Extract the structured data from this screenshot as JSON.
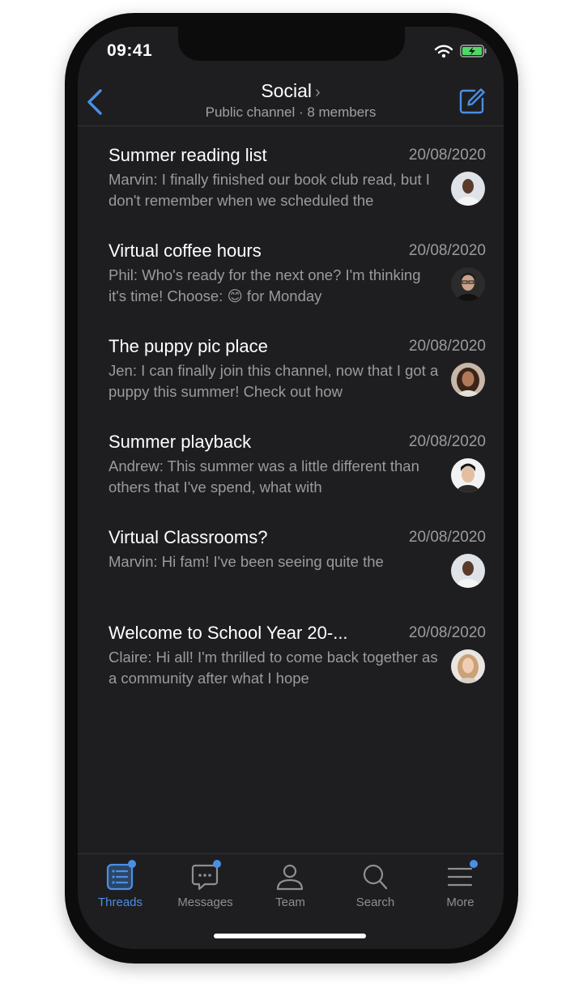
{
  "status": {
    "time": "09:41"
  },
  "header": {
    "title": "Social",
    "subtitle": "Public channel · 8 members"
  },
  "threads": [
    {
      "title": "Summer reading list",
      "date": "20/08/2020",
      "preview": "Marvin: I finally finished our book club read, but I don't remember when we scheduled the",
      "avatar": "avatar-marvin"
    },
    {
      "title": "Virtual coffee hours",
      "date": "20/08/2020",
      "preview": "Phil: Who's ready for the next one? I'm thinking it's time! Choose: 😊 for Monday",
      "avatar": "avatar-phil"
    },
    {
      "title": "The puppy pic place",
      "date": "20/08/2020",
      "preview": "Jen: I can finally join this channel, now that I got a puppy this summer! Check out how",
      "avatar": "avatar-jen"
    },
    {
      "title": "Summer playback",
      "date": "20/08/2020",
      "preview": "Andrew: This summer was a little different than others that I've spend, what with",
      "avatar": "avatar-andrew"
    },
    {
      "title": "Virtual Classrooms?",
      "date": "20/08/2020",
      "preview": "Marvin: Hi fam! I've been seeing quite the",
      "avatar": "avatar-marvin"
    },
    {
      "title": "Welcome to School Year 20-...",
      "date": "20/08/2020",
      "preview": "Claire: Hi all!   I'm thrilled to come back together as a community after what I hope",
      "avatar": "avatar-claire"
    }
  ],
  "tabs": [
    {
      "label": "Threads",
      "icon": "threads-icon",
      "active": true,
      "badge": true
    },
    {
      "label": "Messages",
      "icon": "messages-icon",
      "active": false,
      "badge": true
    },
    {
      "label": "Team",
      "icon": "team-icon",
      "active": false,
      "badge": false
    },
    {
      "label": "Search",
      "icon": "search-icon",
      "active": false,
      "badge": false
    },
    {
      "label": "More",
      "icon": "more-icon",
      "active": false,
      "badge": true
    }
  ],
  "colors": {
    "accent": "#4a8fe6",
    "background": "#1e1e20",
    "muted": "#9a9aa0"
  }
}
